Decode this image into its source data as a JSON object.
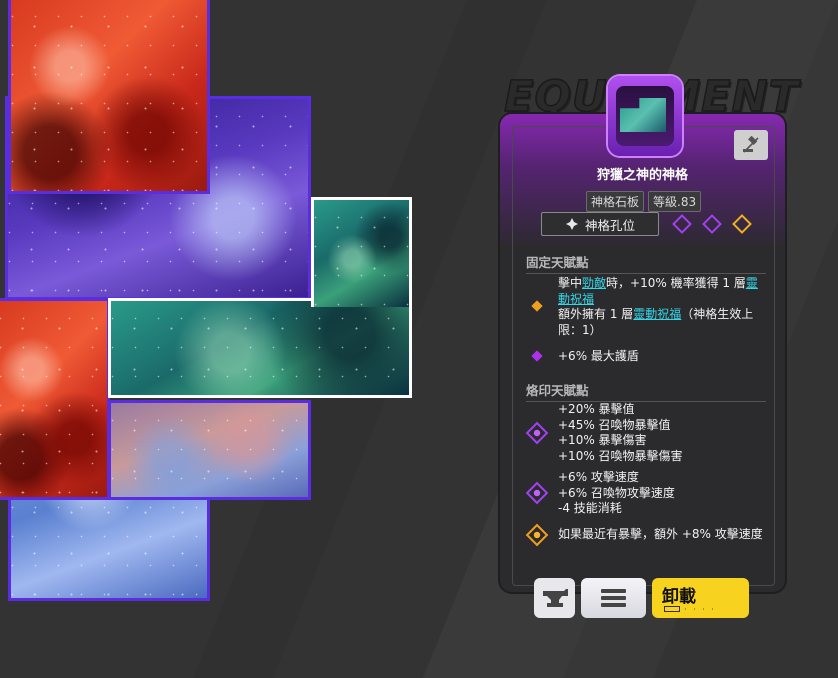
{
  "equipment_watermark": "EQUIPMENT",
  "item": {
    "name": "狩獵之神的神格",
    "tags": [
      "神格石板",
      "等級.83"
    ],
    "slot_button_label": "神格孔位",
    "slot_diamonds": [
      "purple",
      "purple",
      "gold"
    ]
  },
  "fixed_talents": {
    "title": "固定天賦點",
    "entries": [
      {
        "bullet": "orange",
        "segments": [
          {
            "t": "擊中"
          },
          {
            "t": "勁敵",
            "kw": true
          },
          {
            "t": "時，+10% 機率獲得 1 層"
          },
          {
            "t": "靈動祝福",
            "kw": true
          },
          {
            "t": "\n額外擁有 1 層"
          },
          {
            "t": "靈動祝福",
            "kw": true
          },
          {
            "t": "（神格生效上限：1）"
          }
        ]
      },
      {
        "bullet": "purple",
        "segments": [
          {
            "t": "+6% 最大護盾"
          }
        ]
      }
    ]
  },
  "engraved_talents": {
    "title": "烙印天賦點",
    "entries": [
      {
        "diamond": "purple",
        "lines": [
          "+20% 暴擊值",
          "+45% 召喚物暴擊值",
          "+10% 暴擊傷害",
          "+10% 召喚物暴擊傷害"
        ]
      },
      {
        "diamond": "purple",
        "lines": [
          "+6% 攻擊速度",
          "+6% 召喚物攻擊速度",
          "-4 技能消耗"
        ]
      },
      {
        "diamond": "gold",
        "lines": [
          "如果最近有暴擊，額外 +8% 攻擊速度"
        ]
      }
    ]
  },
  "buttons": {
    "unequip_label": "卸載",
    "anvil_icon": "anvil-icon",
    "list_icon": "list-icon"
  },
  "colors": {
    "accent_purple": "#a040f0",
    "accent_gold": "#f0b020",
    "keyword_cyan": "#35d6e8",
    "unequip_yellow": "#f7d21e"
  }
}
